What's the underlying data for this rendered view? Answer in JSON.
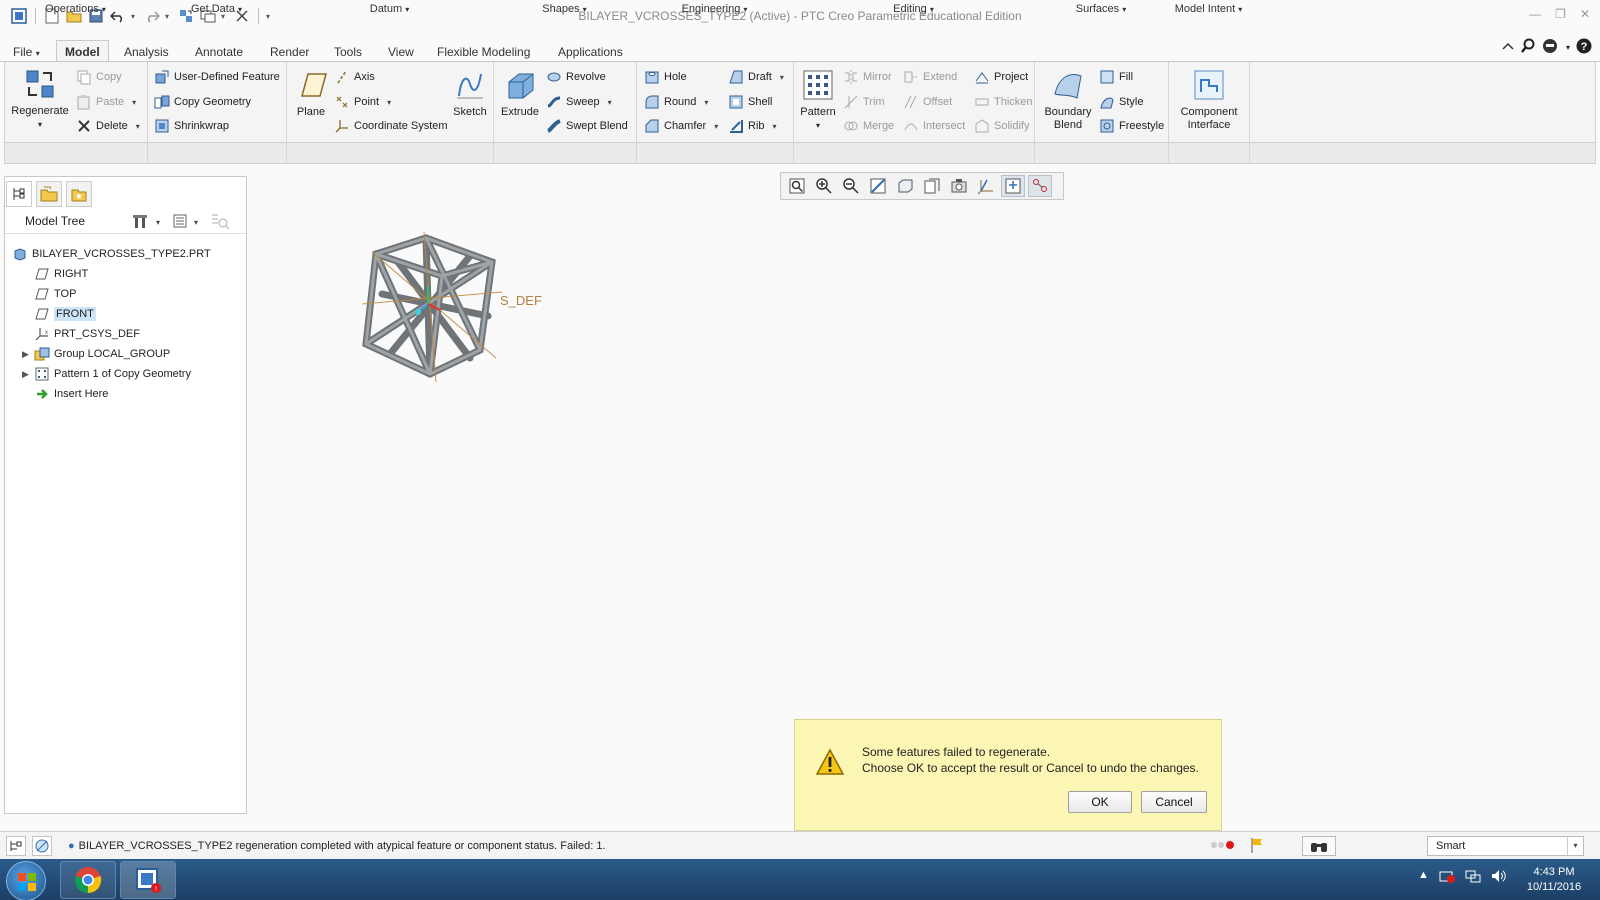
{
  "app": {
    "window_title": "BILAYER_VCROSSES_TYPE2 (Active) - PTC Creo Parametric Educational Edition"
  },
  "ribbon": {
    "file_tab": "File",
    "tabs": [
      "Model",
      "Analysis",
      "Annotate",
      "Render",
      "Tools",
      "View",
      "Flexible Modeling",
      "Applications"
    ],
    "active_tab": "Model",
    "operations": {
      "regenerate": "Regenerate",
      "copy": "Copy",
      "paste": "Paste",
      "delete": "Delete"
    },
    "get_data": {
      "user_defined_feature": "User-Defined Feature",
      "copy_geometry": "Copy Geometry",
      "shrinkwrap": "Shrinkwrap"
    },
    "datum": {
      "plane": "Plane",
      "axis": "Axis",
      "point": "Point",
      "coordinate_system": "Coordinate System",
      "sketch": "Sketch"
    },
    "shapes": {
      "extrude": "Extrude",
      "revolve": "Revolve",
      "sweep": "Sweep",
      "swept_blend": "Swept Blend"
    },
    "engineering": {
      "hole": "Hole",
      "round": "Round",
      "chamfer": "Chamfer",
      "draft": "Draft",
      "shell": "Shell",
      "rib": "Rib"
    },
    "editing": {
      "pattern": "Pattern",
      "mirror": "Mirror",
      "trim": "Trim",
      "merge": "Merge",
      "extend": "Extend",
      "offset": "Offset",
      "intersect": "Intersect",
      "project": "Project",
      "thicken": "Thicken",
      "solidify": "Solidify"
    },
    "surfaces": {
      "boundary_blend_1": "Boundary",
      "boundary_blend_2": "Blend",
      "fill": "Fill",
      "style": "Style",
      "freestyle": "Freestyle"
    },
    "model_intent": {
      "component_interface_1": "Component",
      "component_interface_2": "Interface"
    },
    "groups": [
      "Operations",
      "Get Data",
      "Datum",
      "Shapes",
      "Engineering",
      "Editing",
      "Surfaces",
      "Model Intent"
    ]
  },
  "model_tree": {
    "title": "Model Tree",
    "root": "BILAYER_VCROSSES_TYPE2.PRT",
    "items": [
      {
        "label": "RIGHT",
        "icon": "datum-plane-icon",
        "expandable": false,
        "selected": false
      },
      {
        "label": "TOP",
        "icon": "datum-plane-icon",
        "expandable": false,
        "selected": false
      },
      {
        "label": "FRONT",
        "icon": "datum-plane-icon",
        "expandable": false,
        "selected": true
      },
      {
        "label": "PRT_CSYS_DEF",
        "icon": "csys-icon",
        "expandable": false,
        "selected": false
      },
      {
        "label": "Group LOCAL_GROUP",
        "icon": "group-icon",
        "expandable": true,
        "selected": false
      },
      {
        "label": "Pattern 1 of Copy Geometry",
        "icon": "pattern-icon",
        "expandable": true,
        "selected": false
      },
      {
        "label": "Insert Here",
        "icon": "insert-arrow-icon",
        "expandable": false,
        "selected": false
      }
    ]
  },
  "viewport": {
    "csys_label": "S_DEF"
  },
  "dialog": {
    "line1": "Some features failed to regenerate.",
    "line2": "Choose OK to accept the result or Cancel to undo the changes.",
    "ok": "OK",
    "cancel": "Cancel"
  },
  "status": {
    "message": "BILAYER_VCROSSES_TYPE2 regeneration completed with atypical feature or component status. Failed: 1.",
    "filter": "Smart"
  },
  "taskbar": {
    "time": "4:43 PM",
    "date": "10/11/2016"
  },
  "colors": {
    "dialog_bg": "#fbf6b4",
    "selection": "#cde6f7",
    "taskbar": "#1c3f66"
  }
}
